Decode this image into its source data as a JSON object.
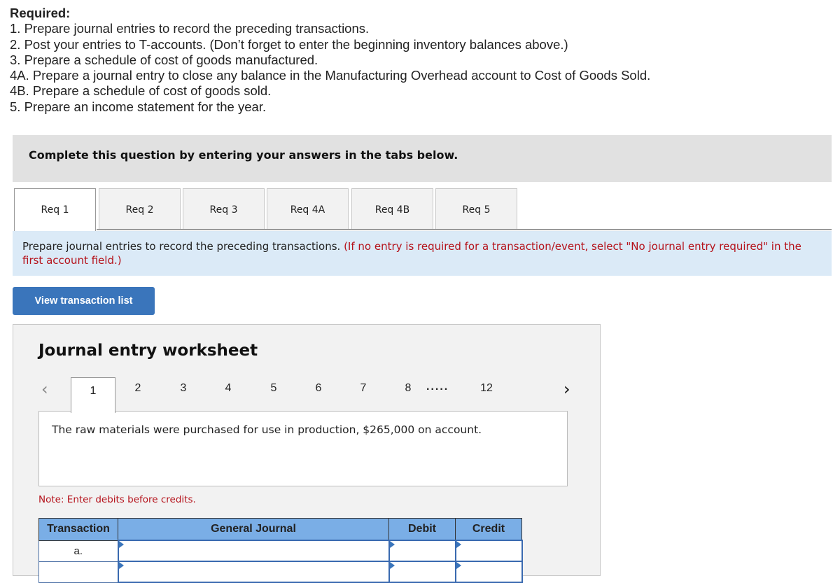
{
  "required": {
    "heading": "Required:",
    "items": [
      "1. Prepare journal entries to record the preceding transactions.",
      "2. Post your entries to T-accounts. (Don’t forget to enter the beginning inventory balances above.)",
      "3. Prepare a schedule of cost of goods manufactured.",
      "4A. Prepare a journal entry to close any balance in the Manufacturing Overhead account to Cost of Goods Sold.",
      "4B. Prepare a schedule of cost of goods sold.",
      "5. Prepare an income statement for the year."
    ]
  },
  "complete_bar": "Complete this question by entering your answers in the tabs below.",
  "tabs": [
    {
      "label": "Req 1",
      "active": true
    },
    {
      "label": "Req 2",
      "active": false
    },
    {
      "label": "Req 3",
      "active": false
    },
    {
      "label": "Req 4A",
      "active": false
    },
    {
      "label": "Req 4B",
      "active": false
    },
    {
      "label": "Req 5",
      "active": false
    }
  ],
  "instruction": {
    "text": "Prepare journal entries to record the preceding transactions. ",
    "note": "(If no entry is required for a transaction/event, select \"No journal entry required\" in the first account field.)"
  },
  "view_button": "View transaction list",
  "worksheet": {
    "title": "Journal entry worksheet",
    "pager": {
      "prev_icon": "chevron-left-icon",
      "next_icon": "chevron-right-icon",
      "active": "1",
      "pages": [
        "2",
        "3",
        "4",
        "5",
        "6",
        "7",
        "8"
      ],
      "ellipsis": ".....",
      "last": "12"
    },
    "description": "The raw materials were purchased for use in production, $265,000 on account.",
    "note": "Note: Enter debits before credits.",
    "table": {
      "headers": [
        "Transaction",
        "General Journal",
        "Debit",
        "Credit"
      ],
      "rows": [
        {
          "transaction": "a.",
          "account": "",
          "debit": "",
          "credit": ""
        },
        {
          "transaction": "",
          "account": "",
          "debit": "",
          "credit": ""
        }
      ]
    }
  }
}
